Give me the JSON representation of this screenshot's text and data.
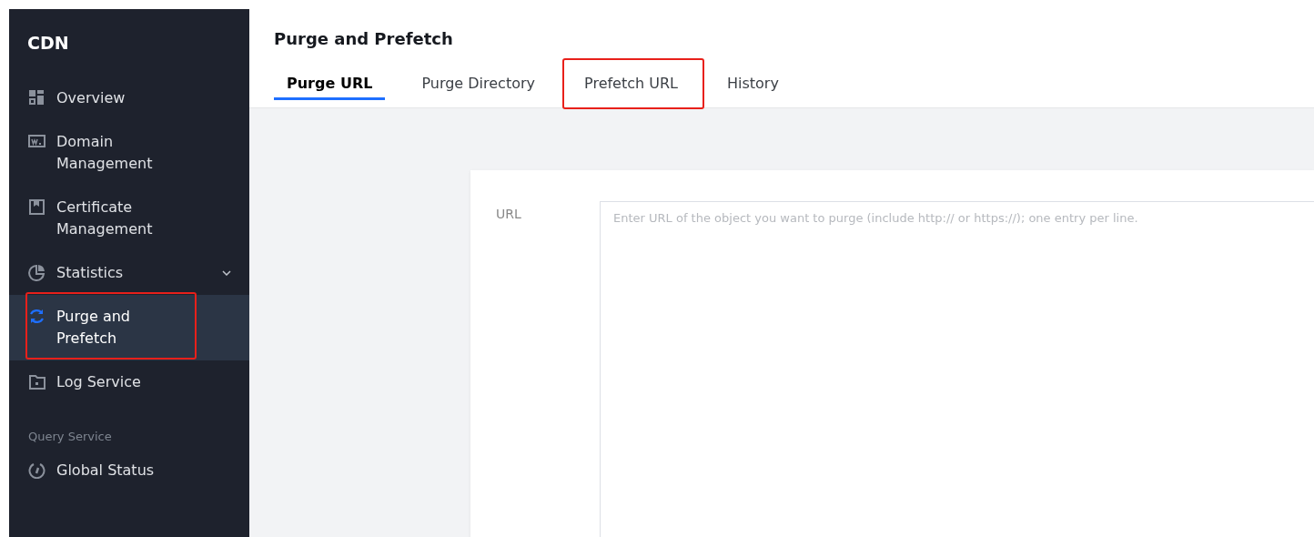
{
  "sidebar": {
    "title": "CDN",
    "items": [
      {
        "label": "Overview",
        "selected": false,
        "highlighted": false,
        "expandable": false
      },
      {
        "label": "Domain Management",
        "selected": false,
        "highlighted": false,
        "expandable": false
      },
      {
        "label": "Certificate Management",
        "selected": false,
        "highlighted": false,
        "expandable": false
      },
      {
        "label": "Statistics",
        "selected": false,
        "highlighted": false,
        "expandable": true
      },
      {
        "label": "Purge and Prefetch",
        "selected": true,
        "highlighted": true,
        "expandable": false
      },
      {
        "label": "Log Service",
        "selected": false,
        "highlighted": false,
        "expandable": false
      }
    ],
    "section": "Query Service",
    "section_items": [
      {
        "label": "Global Status",
        "selected": false,
        "highlighted": false,
        "expandable": false
      }
    ]
  },
  "page": {
    "title": "Purge and Prefetch"
  },
  "tabs": [
    {
      "label": "Purge URL",
      "selected": true,
      "highlighted": false
    },
    {
      "label": "Purge Directory",
      "selected": false,
      "highlighted": false
    },
    {
      "label": "Prefetch URL",
      "selected": false,
      "highlighted": true
    },
    {
      "label": "History",
      "selected": false,
      "highlighted": false
    }
  ],
  "form": {
    "label": "URL",
    "placeholder": "Enter URL of the object you want to purge (include http:// or https://); one entry per line."
  }
}
